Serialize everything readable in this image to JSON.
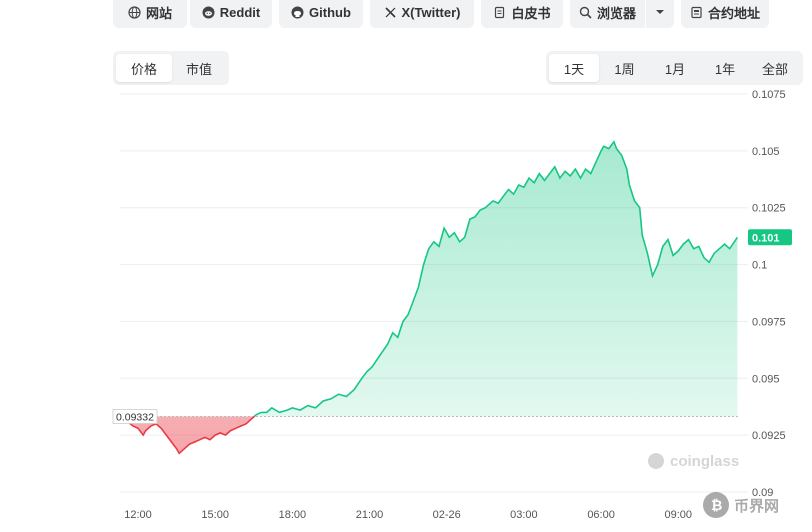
{
  "links": [
    {
      "label": "网站",
      "icon": "globe-icon"
    },
    {
      "label": "Reddit",
      "icon": "reddit-icon"
    },
    {
      "label": "Github",
      "icon": "github-icon"
    },
    {
      "label": "X(Twitter)",
      "icon": "x-icon"
    },
    {
      "label": "白皮书",
      "icon": "document-icon"
    },
    {
      "label": "浏览器",
      "icon": "search-icon"
    },
    {
      "label": "合约地址",
      "icon": "contract-icon"
    }
  ],
  "metric_tabs": [
    {
      "label": "价格",
      "active": true
    },
    {
      "label": "市值",
      "active": false
    }
  ],
  "range_tabs": [
    {
      "label": "1天",
      "active": true
    },
    {
      "label": "1周",
      "active": false
    },
    {
      "label": "1月",
      "active": false
    },
    {
      "label": "1年",
      "active": false
    },
    {
      "label": "全部",
      "active": false
    }
  ],
  "watermark": "coinglass",
  "corner_logo_text": "币界网",
  "colors": {
    "up_line": "#16c784",
    "down_line": "#ea3943",
    "up_fill": "#16c784",
    "down_fill": "#ea3943"
  },
  "chart_data": {
    "type": "area",
    "baseline": 0.09332,
    "baseline_label": "0.09332",
    "current_label": "0.101",
    "ylim": [
      0.09,
      0.1075
    ],
    "yticks": [
      "0.1075",
      "0.105",
      "0.1025",
      "0.1",
      "0.0975",
      "0.095",
      "0.0925",
      "0.09"
    ],
    "xticks": [
      "12:00",
      "15:00",
      "18:00",
      "21:00",
      "02-26",
      "03:00",
      "06:00",
      "09:00"
    ],
    "xtick_hours": [
      12,
      15,
      18,
      21,
      24,
      27,
      30,
      33
    ],
    "xlim_hours": [
      11.3,
      35.4
    ],
    "series": [
      {
        "values": [
          [
            11.6,
            0.0931
          ],
          [
            11.8,
            0.0929
          ],
          [
            12.0,
            0.0928
          ],
          [
            12.2,
            0.0925
          ],
          [
            12.3,
            0.0927
          ],
          [
            12.5,
            0.0929
          ],
          [
            12.7,
            0.093
          ],
          [
            12.9,
            0.0928
          ],
          [
            13.1,
            0.0925
          ],
          [
            13.3,
            0.0922
          ],
          [
            13.5,
            0.0919
          ],
          [
            13.6,
            0.0917
          ],
          [
            13.8,
            0.0919
          ],
          [
            14.0,
            0.0921
          ],
          [
            14.2,
            0.0922
          ],
          [
            14.4,
            0.0923
          ],
          [
            14.6,
            0.0924
          ],
          [
            14.8,
            0.0923
          ],
          [
            15.0,
            0.0925
          ],
          [
            15.2,
            0.0926
          ],
          [
            15.4,
            0.0925
          ],
          [
            15.6,
            0.0927
          ],
          [
            15.8,
            0.0928
          ],
          [
            16.0,
            0.0929
          ],
          [
            16.2,
            0.093
          ],
          [
            16.4,
            0.0932
          ],
          [
            16.6,
            0.0934
          ],
          [
            16.8,
            0.0935
          ],
          [
            17.0,
            0.0935
          ],
          [
            17.2,
            0.0937
          ],
          [
            17.5,
            0.0935
          ],
          [
            17.8,
            0.0936
          ],
          [
            18.0,
            0.0937
          ],
          [
            18.3,
            0.0936
          ],
          [
            18.6,
            0.0938
          ],
          [
            18.9,
            0.0937
          ],
          [
            19.2,
            0.094
          ],
          [
            19.5,
            0.0941
          ],
          [
            19.8,
            0.0943
          ],
          [
            20.1,
            0.0942
          ],
          [
            20.4,
            0.0945
          ],
          [
            20.7,
            0.095
          ],
          [
            20.9,
            0.0953
          ],
          [
            21.1,
            0.0955
          ],
          [
            21.4,
            0.096
          ],
          [
            21.7,
            0.0965
          ],
          [
            21.9,
            0.097
          ],
          [
            22.1,
            0.0968
          ],
          [
            22.3,
            0.0975
          ],
          [
            22.5,
            0.0978
          ],
          [
            22.7,
            0.0984
          ],
          [
            22.9,
            0.099
          ],
          [
            23.1,
            0.1
          ],
          [
            23.3,
            0.1007
          ],
          [
            23.5,
            0.101
          ],
          [
            23.7,
            0.1008
          ],
          [
            23.9,
            0.1016
          ],
          [
            24.1,
            0.1012
          ],
          [
            24.3,
            0.1014
          ],
          [
            24.5,
            0.101
          ],
          [
            24.7,
            0.1012
          ],
          [
            24.9,
            0.102
          ],
          [
            25.1,
            0.1021
          ],
          [
            25.3,
            0.1024
          ],
          [
            25.5,
            0.1025
          ],
          [
            25.8,
            0.1028
          ],
          [
            26.0,
            0.1027
          ],
          [
            26.2,
            0.103
          ],
          [
            26.4,
            0.1033
          ],
          [
            26.6,
            0.1031
          ],
          [
            26.8,
            0.1035
          ],
          [
            27.0,
            0.1034
          ],
          [
            27.2,
            0.1038
          ],
          [
            27.4,
            0.1036
          ],
          [
            27.6,
            0.104
          ],
          [
            27.8,
            0.1037
          ],
          [
            28.0,
            0.104
          ],
          [
            28.2,
            0.1043
          ],
          [
            28.4,
            0.1038
          ],
          [
            28.6,
            0.1041
          ],
          [
            28.8,
            0.1039
          ],
          [
            29.0,
            0.1042
          ],
          [
            29.2,
            0.1038
          ],
          [
            29.4,
            0.1042
          ],
          [
            29.6,
            0.104
          ],
          [
            29.8,
            0.1045
          ],
          [
            30.0,
            0.105
          ],
          [
            30.1,
            0.1052
          ],
          [
            30.3,
            0.1051
          ],
          [
            30.5,
            0.1054
          ],
          [
            30.6,
            0.1051
          ],
          [
            30.8,
            0.1048
          ],
          [
            31.0,
            0.1042
          ],
          [
            31.1,
            0.1035
          ],
          [
            31.3,
            0.1028
          ],
          [
            31.5,
            0.1025
          ],
          [
            31.6,
            0.1013
          ],
          [
            31.8,
            0.1005
          ],
          [
            32.0,
            0.0995
          ],
          [
            32.2,
            0.1
          ],
          [
            32.4,
            0.1008
          ],
          [
            32.6,
            0.1011
          ],
          [
            32.8,
            0.1004
          ],
          [
            33.0,
            0.1006
          ],
          [
            33.2,
            0.1009
          ],
          [
            33.4,
            0.1011
          ],
          [
            33.6,
            0.1007
          ],
          [
            33.8,
            0.1008
          ],
          [
            34.0,
            0.1003
          ],
          [
            34.2,
            0.1001
          ],
          [
            34.4,
            0.1005
          ],
          [
            34.6,
            0.1007
          ],
          [
            34.8,
            0.1009
          ],
          [
            35.0,
            0.1007
          ],
          [
            35.3,
            0.1012
          ]
        ]
      }
    ]
  }
}
